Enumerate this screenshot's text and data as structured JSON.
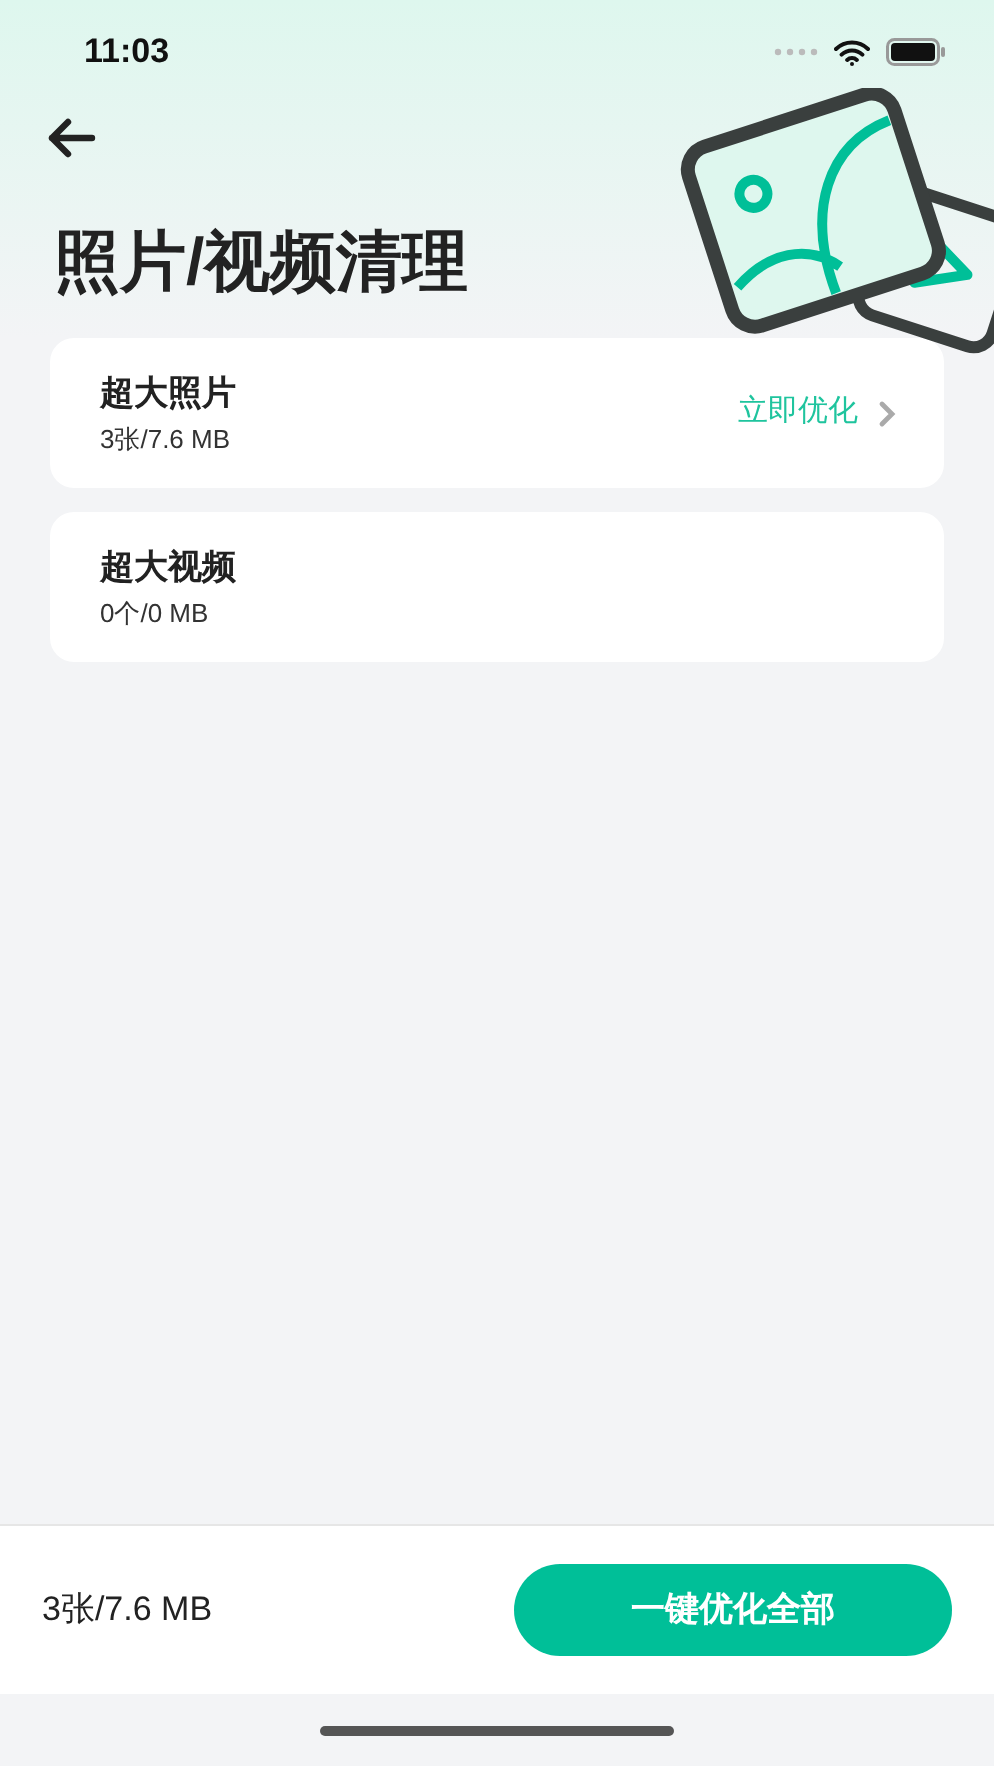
{
  "status_bar": {
    "time": "11:03"
  },
  "title": "照片/视频清理",
  "items": [
    {
      "title": "超大照片",
      "subtitle": "3张/7.6 MB",
      "action": "立即优化"
    },
    {
      "title": "超大视频",
      "subtitle": "0个/0 MB"
    }
  ],
  "footer": {
    "summary": "3张/7.6 MB",
    "button": "一键优化全部"
  }
}
